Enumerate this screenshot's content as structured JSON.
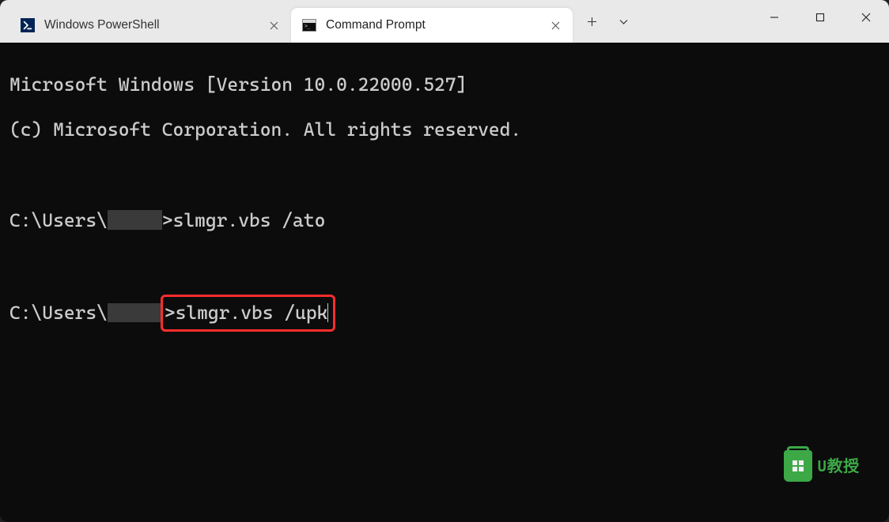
{
  "tabs": [
    {
      "title": "Windows PowerShell",
      "icon": "powershell-icon",
      "active": false
    },
    {
      "title": "Command Prompt",
      "icon": "cmd-icon",
      "active": true
    }
  ],
  "terminal": {
    "banner1": "Microsoft Windows [Version 10.0.22000.527]",
    "banner2": "(c) Microsoft Corporation. All rights reserved.",
    "prompt_prefix": "C:\\Users\\",
    "redacted": "     ",
    "prompt_suffix": ">",
    "command1": "slmgr.vbs /ato",
    "command2": "slmgr.vbs /upk"
  },
  "watermark": {
    "text": "U教授"
  }
}
